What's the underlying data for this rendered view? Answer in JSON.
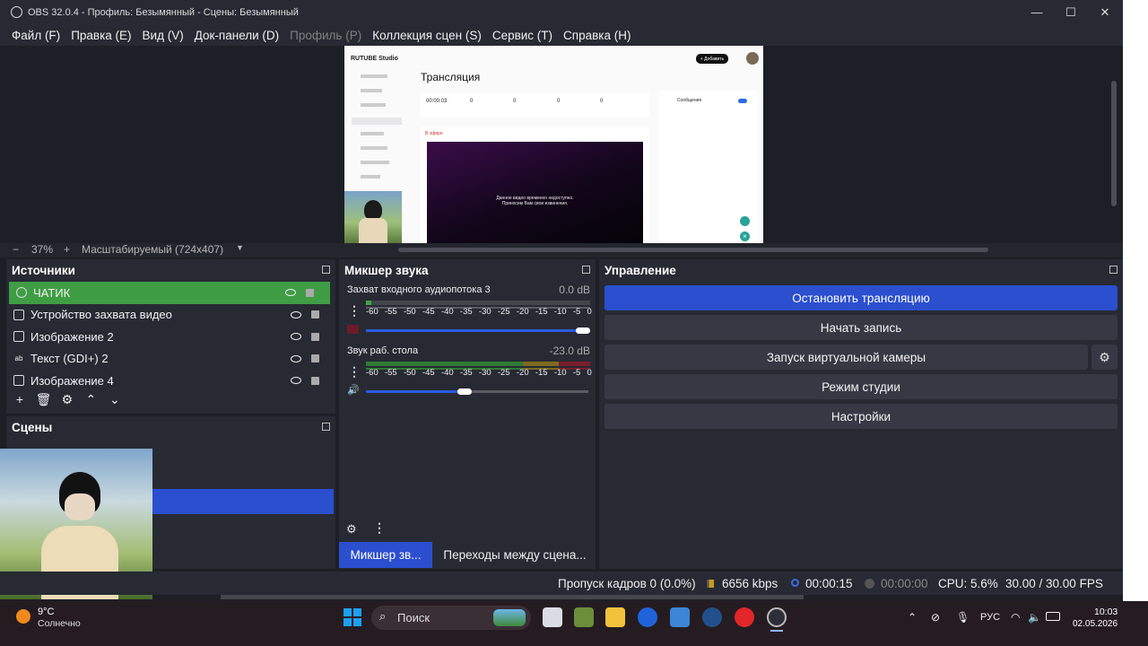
{
  "window": {
    "title": "OBS 32.0.4 - Профиль: Безымянный - Сцены: Безымянный",
    "min": "—",
    "max": "☐",
    "close": "✕"
  },
  "menu": [
    {
      "label": "Файл (F)"
    },
    {
      "label": "Правка (E)"
    },
    {
      "label": "Вид (V)"
    },
    {
      "label": "Док-панели (D)"
    },
    {
      "label": "Профиль (P)",
      "disabled": true
    },
    {
      "label": "Коллекция сцен (S)"
    },
    {
      "label": "Сервис (T)"
    },
    {
      "label": "Справка (H)"
    }
  ],
  "preview": {
    "studio_logo": "RUTUBE Studio",
    "add_btn": "+ Добавить",
    "page_title": "Трансляция",
    "stats": [
      {
        "value": "00:00:03"
      },
      {
        "value": "0"
      },
      {
        "value": "0"
      },
      {
        "value": "0"
      },
      {
        "value": "0"
      }
    ],
    "live_label": "В эфире",
    "chat_title": "Сообщения",
    "stream_msg1": "Данное видео временно недоступно.",
    "stream_msg2": "Приносим Вам свои извинения."
  },
  "zoom": {
    "minus": "−",
    "percent": "37%",
    "plus": "+",
    "mode": "Масштабируемый (724x407)"
  },
  "sources": {
    "title": "Источники",
    "items": [
      {
        "label": "ЧАТИК",
        "selected": true
      },
      {
        "label": "Устройство захвата видео"
      },
      {
        "label": "Изображение 2"
      },
      {
        "label": "Текст (GDI+) 2"
      },
      {
        "label": "Изображение 4"
      }
    ]
  },
  "scenes": {
    "title": "Сцены"
  },
  "mixer": {
    "title": "Микшер звука",
    "channels": [
      {
        "name": "Захват входного аудиопотока 3",
        "db": "0.0 dB",
        "level": 0.02,
        "fader": 1.0
      },
      {
        "name": "Звук раб. стола",
        "db": "-23.0 dB",
        "level": 0.0,
        "fader": 0.46
      }
    ],
    "scale": [
      "-60",
      "-55",
      "-50",
      "-45",
      "-40",
      "-35",
      "-30",
      "-25",
      "-20",
      "-15",
      "-10",
      "-5",
      "0"
    ],
    "tab_mixer": "Микшер зв...",
    "tab_transitions": "Переходы между сцена..."
  },
  "controls": {
    "title": "Управление",
    "stop_stream": "Остановить трансляцию",
    "start_record": "Начать запись",
    "virtual_cam": "Запуск виртуальной камеры",
    "studio_mode": "Режим студии",
    "settings": "Настройки"
  },
  "status": {
    "dropped": "Пропуск кадров 0 (0.0%)",
    "bitrate": "6656 kbps",
    "stream_time": "00:00:15",
    "rec_time": "00:00:00",
    "cpu": "CPU: 5.6%",
    "fps": "30.00 / 30.00 FPS"
  },
  "taskbar": {
    "weather_temp": "9°C",
    "weather_desc": "Солнечно",
    "search": "Поиск",
    "lang": "РУС",
    "time": "10:03",
    "date": "02.05.2026"
  },
  "colors": {
    "accent": "#2b5be0",
    "selected_source": "#3f9d44",
    "bg": "#1d1f26"
  }
}
